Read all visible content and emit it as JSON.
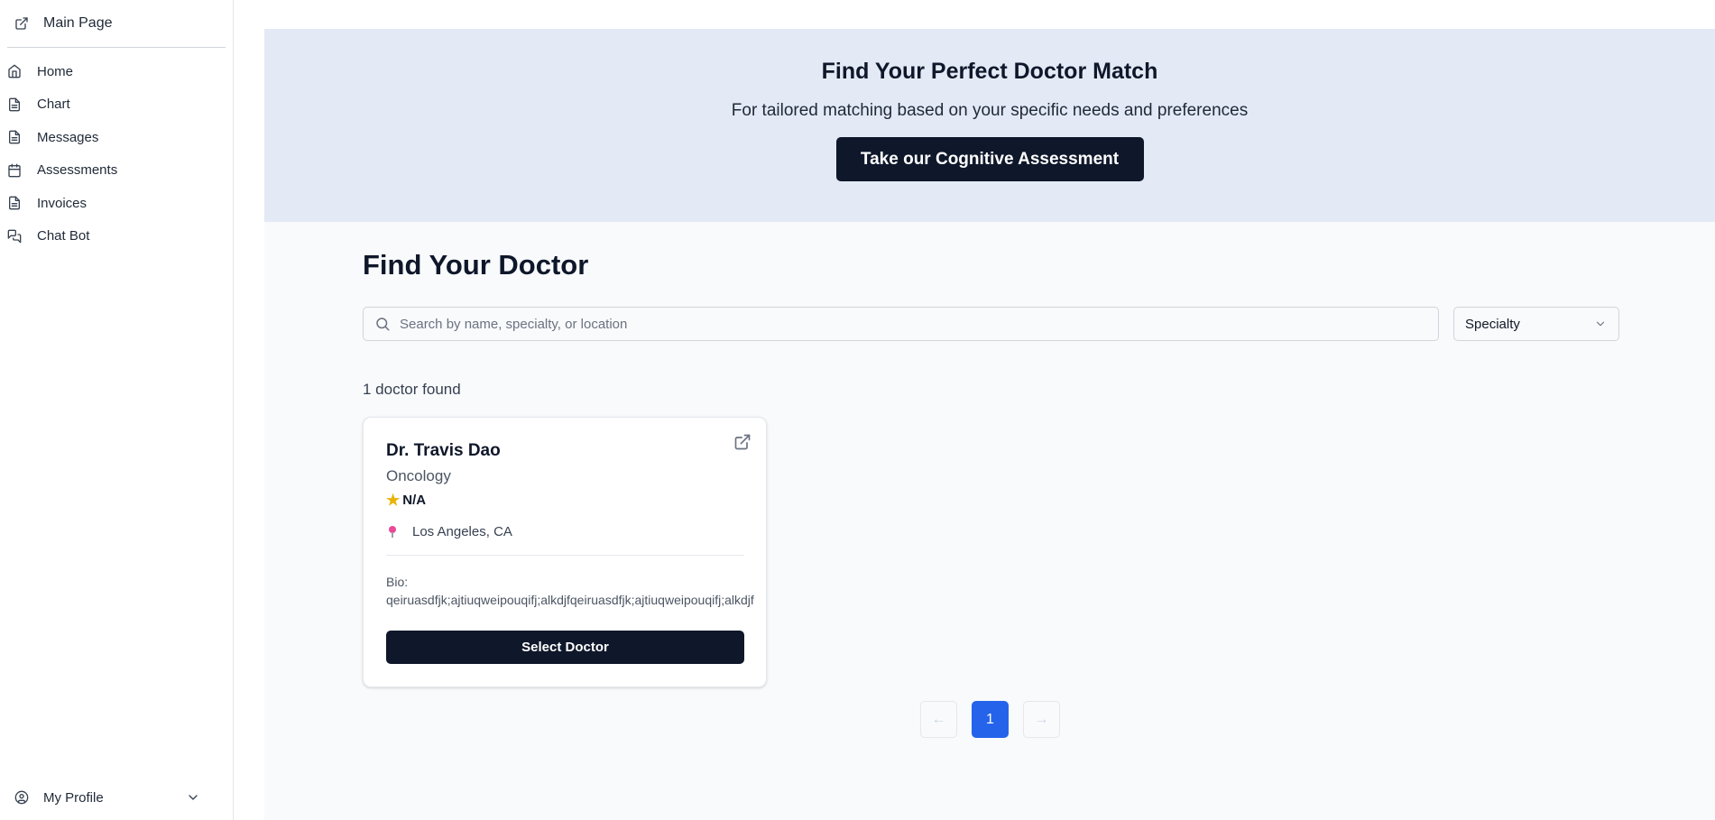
{
  "sidebar": {
    "main_page": "Main Page",
    "items": [
      {
        "label": "Home",
        "icon": "home-icon"
      },
      {
        "label": "Chart",
        "icon": "document-icon"
      },
      {
        "label": "Messages",
        "icon": "document-icon"
      },
      {
        "label": "Assessments",
        "icon": "calendar-icon"
      },
      {
        "label": "Invoices",
        "icon": "document-icon"
      },
      {
        "label": "Chat Bot",
        "icon": "chat-icon"
      }
    ],
    "profile": "My Profile"
  },
  "hero": {
    "title": "Find Your Perfect Doctor Match",
    "subtitle": "For tailored matching based on your specific needs and preferences",
    "button": "Take our Cognitive Assessment"
  },
  "search_section": {
    "heading": "Find Your Doctor",
    "search_placeholder": "Search by name, specialty, or location",
    "specialty_select": "Specialty",
    "result_count": "1 doctor found"
  },
  "doctors": [
    {
      "name": "Dr. Travis Dao",
      "specialty": "Oncology",
      "rating": "N/A",
      "location": "Los Angeles, CA",
      "bio_label": "Bio:",
      "bio": "qeiruasdfjk;ajtiuqweipouqifj;alkdjfqeiruasdfjk;ajtiuqweipouqifj;alkdjf",
      "select_label": "Select Doctor"
    }
  ],
  "pagination": {
    "prev": "←",
    "current": "1",
    "next": "→"
  },
  "colors": {
    "primary": "#0f172a",
    "accent": "#2563eb",
    "hero_bg": "#e3eaf6",
    "star": "#eab308",
    "pin": "#ec4899"
  }
}
